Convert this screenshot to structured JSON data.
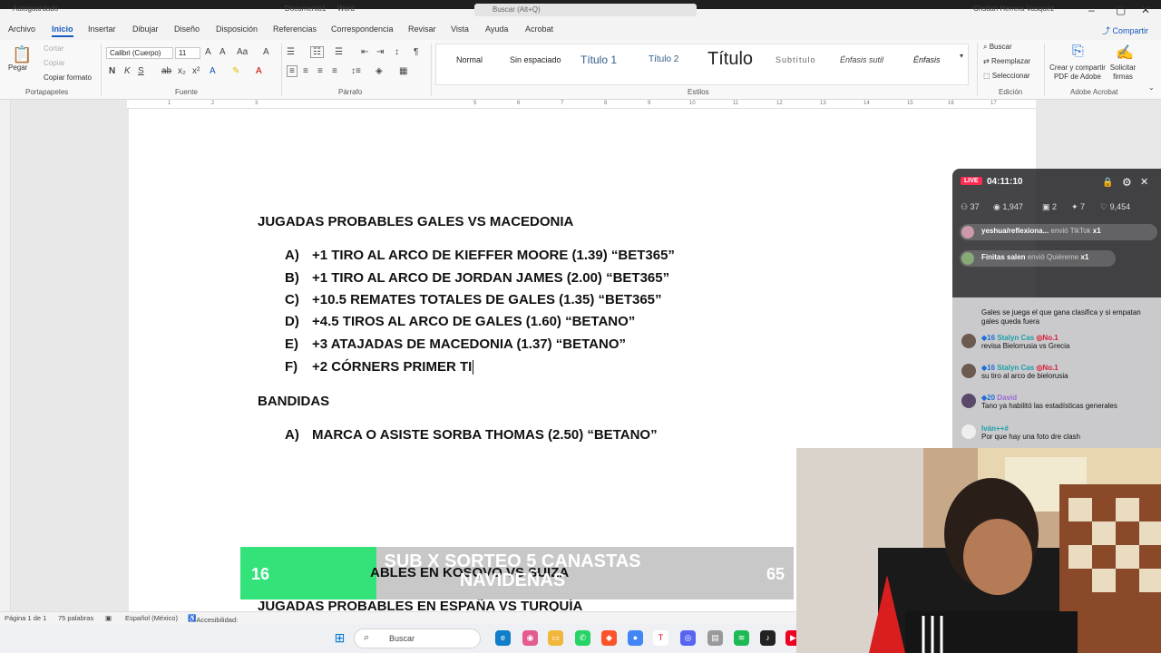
{
  "titlebar": {
    "autosave": "Autoguardado",
    "doc_title": "Documento1",
    "app": "Word",
    "search_placeholder": "Buscar (Alt+Q)",
    "user": "Cristian Herrera Vasquez"
  },
  "menu": {
    "tabs": [
      "Archivo",
      "Inicio",
      "Insertar",
      "Dibujar",
      "Diseño",
      "Disposición",
      "Referencias",
      "Correspondencia",
      "Revisar",
      "Vista",
      "Ayuda",
      "Acrobat"
    ],
    "share": "Compartir"
  },
  "ribbon": {
    "clipboard": {
      "paste": "Pegar",
      "cut": "Cortar",
      "copy": "Copiar",
      "format_painter": "Copiar formato",
      "label": "Portapapeles"
    },
    "font": {
      "family": "Calibri (Cuerpo)",
      "size": "11",
      "label": "Fuente"
    },
    "paragraph": {
      "label": "Párrafo"
    },
    "styles": {
      "items": [
        "Normal",
        "Sin espaciado",
        "Título 1",
        "Título 2",
        "Título",
        "Subtítulo",
        "Énfasis sutil",
        "Énfasis"
      ],
      "label": "Estilos"
    },
    "editing": {
      "find": "Buscar",
      "replace": "Reemplazar",
      "select": "Seleccionar",
      "label": "Edición"
    },
    "acrobat": {
      "create_pdf": "Crear y compartir PDF de Adobe",
      "request": "Solicitar firmas",
      "label": "Adobe Acrobat"
    }
  },
  "document": {
    "heading": "JUGADAS PROBABLES GALES VS MACEDONIA",
    "items": [
      {
        "letter": "A)",
        "text": "+1 TIRO AL ARCO DE KIEFFER MOORE (1.39) “BET365”"
      },
      {
        "letter": "B)",
        "text": "+1 TIRO AL ARCO DE JORDAN JAMES (2.00) “BET365”"
      },
      {
        "letter": "C)",
        "text": "+10.5 REMATES TOTALES DE GALES (1.35) “BET365”"
      },
      {
        "letter": "D)",
        "text": "+4.5 TIROS AL ARCO DE GALES (1.60) “BETANO”"
      },
      {
        "letter": "E)",
        "text": "+3 ATAJADAS DE MACEDONIA (1.37) “BETANO”"
      },
      {
        "letter": "F)",
        "text": "+2 CÓRNERS PRIMER TI"
      }
    ],
    "heading2": "BANDIDAS",
    "items2": [
      {
        "letter": "A)",
        "text": "MARCA O ASISTE SORBA THOMAS (2.50) “BETANO”"
      }
    ],
    "partial1": "ABLES EN KOSOVO VS SUIZA",
    "partial2": "JUGADAS PROBABLES EN ESPAÑA VS TURQUÍA"
  },
  "statusbar": {
    "page": "Página 1 de 1",
    "words": "75 palabras",
    "lang": "Español (México)",
    "access": "Accesibilidad: todo correcto"
  },
  "taskbar": {
    "search": "Buscar"
  },
  "live": {
    "badge": "LIVE",
    "time": "04:11:10",
    "stats": [
      "37",
      "1,947",
      "2",
      "7",
      "9,454"
    ],
    "gifts": [
      {
        "user": "yeshua/reflexiona...",
        "action": "envió TikTok",
        "count": "x1"
      },
      {
        "user": "Finitas salen",
        "action": "envió Quiéreme",
        "count": "x1"
      }
    ],
    "chat": [
      {
        "user": "",
        "text": "Gales se juega el que gana clasifica y si empatan gales queda fuera"
      },
      {
        "level": "16",
        "user": "Stalyn Cas",
        "rank": "No.1",
        "text": "revisa Bielorrusia vs Grecia"
      },
      {
        "level": "16",
        "user": "Stalyn Cas",
        "rank": "No.1",
        "text": "su tiro al arco de bielorusia"
      },
      {
        "level": "20",
        "user": "David",
        "text": "Tano ya habilitó las estadísticas generales"
      },
      {
        "user": "Iván++#",
        "text": "Por que hay una foto dre clash"
      }
    ]
  },
  "goal": {
    "current": "16",
    "target": "65",
    "progress": 0.246,
    "label": "SUB X SORTEO 5 CANASTAS NAVIDEÑAS"
  },
  "colors": {
    "word_blue": "#185abd",
    "live_red": "#fe2c55",
    "goal_green": "#33e37a"
  }
}
